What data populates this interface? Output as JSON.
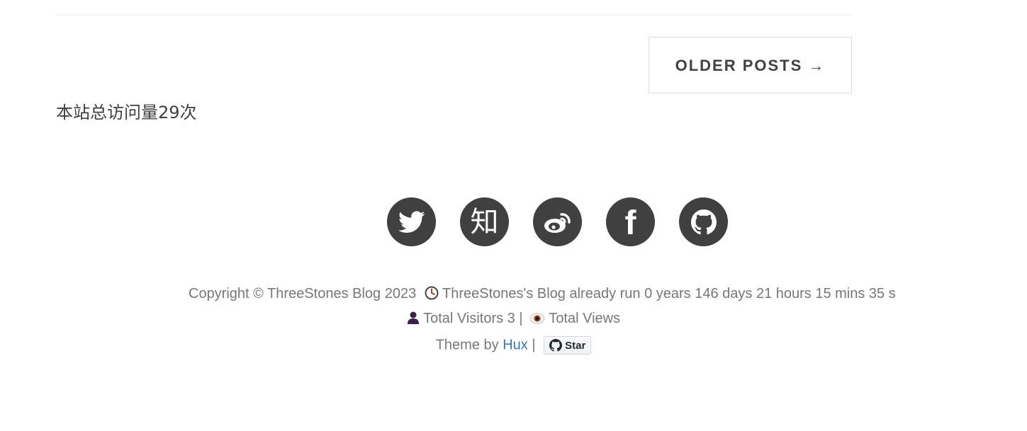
{
  "pager": {
    "older_posts_label": "OLDER POSTS →"
  },
  "site_stats": {
    "visit_count_text": "本站总访问量29次"
  },
  "social": {
    "items": [
      {
        "name": "twitter",
        "icon": "twitter-icon"
      },
      {
        "name": "zhihu",
        "icon": "zhihu-icon",
        "glyph": "知"
      },
      {
        "name": "weibo",
        "icon": "weibo-icon"
      },
      {
        "name": "facebook",
        "icon": "facebook-icon",
        "glyph": "f"
      },
      {
        "name": "github",
        "icon": "github-icon"
      }
    ],
    "color": "#404040"
  },
  "footer": {
    "copyright": "Copyright © ThreeStones Blog 2023",
    "runtime_text": "ThreeStones's Blog already run 0 years 146 days 21 hours 15 mins 35 s",
    "visitors_text": "Total Visitors 3 |",
    "views_text": "Total Views",
    "theme_by": "Theme by",
    "theme_author": "Hux",
    "separator": "|",
    "star_label": "Star"
  },
  "colors": {
    "text": "#404040",
    "muted": "#777777",
    "link": "#337ab7"
  }
}
